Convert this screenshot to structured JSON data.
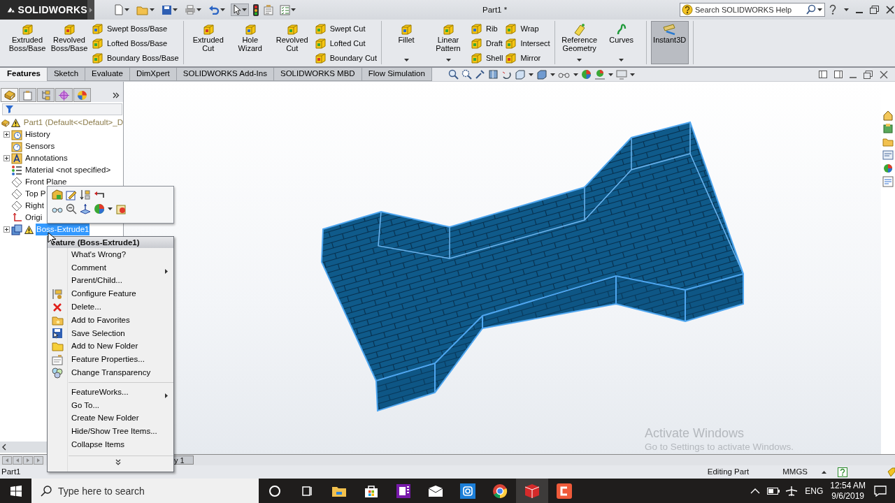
{
  "app": {
    "logo": "SOLIDWORKS",
    "title": "Part1 *",
    "search_placeholder": "Search SOLIDWORKS Help"
  },
  "ribbon": {
    "groups": [
      {
        "items": [
          {
            "kind": "large",
            "label": "Extruded Boss/Base",
            "dropdown": false,
            "pressed": false
          },
          {
            "kind": "large",
            "label": "Revolved Boss/Base",
            "dropdown": false,
            "pressed": false
          },
          {
            "kind": "stack",
            "labels": [
              "Swept Boss/Base",
              "Lofted Boss/Base",
              "Boundary Boss/Base"
            ]
          }
        ]
      },
      {
        "items": [
          {
            "kind": "large",
            "label": "Extruded Cut",
            "dropdown": false,
            "pressed": false
          },
          {
            "kind": "large",
            "label": "Hole Wizard",
            "dropdown": false,
            "pressed": false
          },
          {
            "kind": "large",
            "label": "Revolved Cut",
            "dropdown": false,
            "pressed": false
          },
          {
            "kind": "stack",
            "labels": [
              "Swept Cut",
              "Lofted Cut",
              "Boundary Cut"
            ]
          }
        ]
      },
      {
        "items": [
          {
            "kind": "large",
            "label": "Fillet",
            "dropdown": true,
            "pressed": false
          },
          {
            "kind": "large",
            "label": "Linear Pattern",
            "dropdown": true,
            "pressed": false
          },
          {
            "kind": "stack",
            "labels": [
              "Rib",
              "Draft",
              "Shell"
            ]
          },
          {
            "kind": "stack",
            "labels": [
              "Wrap",
              "Intersect",
              "Mirror"
            ]
          }
        ]
      },
      {
        "items": [
          {
            "kind": "large",
            "label": "Reference Geometry",
            "dropdown": true,
            "pressed": false
          },
          {
            "kind": "large",
            "label": "Curves",
            "dropdown": true,
            "pressed": false
          }
        ]
      },
      {
        "items": [
          {
            "kind": "large",
            "label": "Instant3D",
            "dropdown": false,
            "pressed": true
          }
        ]
      }
    ]
  },
  "tabs": [
    {
      "label": "Features",
      "selected": true
    },
    {
      "label": "Sketch",
      "selected": false
    },
    {
      "label": "Evaluate",
      "selected": false
    },
    {
      "label": "DimXpert",
      "selected": false
    },
    {
      "label": "SOLIDWORKS Add-Ins",
      "selected": false
    },
    {
      "label": "SOLIDWORKS MBD",
      "selected": false
    },
    {
      "label": "Flow Simulation",
      "selected": false
    }
  ],
  "tree": {
    "root": {
      "label": "Part1  (Default<<Default>_D",
      "warning": true
    },
    "items": [
      {
        "label": "History",
        "kind": "history",
        "collapsed": true,
        "warning": false,
        "selected": false
      },
      {
        "label": "Sensors",
        "kind": "sensors",
        "collapsed": false,
        "warning": false,
        "selected": false
      },
      {
        "label": "Annotations",
        "kind": "annotations",
        "collapsed": true,
        "warning": false,
        "selected": false
      },
      {
        "label": "Material <not specified>",
        "kind": "material",
        "collapsed": false,
        "warning": false,
        "selected": false
      },
      {
        "label": "Front Plane",
        "kind": "plane",
        "collapsed": false,
        "warning": false,
        "selected": false
      },
      {
        "label": "Top P",
        "kind": "plane",
        "collapsed": false,
        "warning": false,
        "selected": false
      },
      {
        "label": "Right",
        "kind": "plane",
        "collapsed": false,
        "warning": false,
        "selected": false
      },
      {
        "label": "Origi",
        "kind": "origin",
        "collapsed": false,
        "warning": false,
        "selected": false
      },
      {
        "label": "Boss-Extrude1",
        "kind": "feature",
        "collapsed": true,
        "warning": true,
        "selected": true
      }
    ]
  },
  "context_menu": {
    "title": "eature (Boss-Extrude1)",
    "sections": [
      [
        {
          "label": "What's Wrong?",
          "submenu": false
        },
        {
          "label": "Comment",
          "submenu": true
        },
        {
          "label": "Parent/Child...",
          "submenu": false
        },
        {
          "label": "Configure Feature",
          "submenu": false
        },
        {
          "label": "Delete...",
          "submenu": false
        },
        {
          "label": "Add to Favorites",
          "submenu": false
        },
        {
          "label": "Save Selection",
          "submenu": false
        },
        {
          "label": "Add to New Folder",
          "submenu": false
        },
        {
          "label": "Feature Properties...",
          "submenu": false
        },
        {
          "label": "Change Transparency",
          "submenu": false
        }
      ],
      [
        {
          "label": "FeatureWorks...",
          "submenu": true
        },
        {
          "label": "Go To...",
          "submenu": false
        },
        {
          "label": "Create New Folder",
          "submenu": false
        },
        {
          "label": "Hide/Show Tree Items...",
          "submenu": false
        },
        {
          "label": "Collapse Items",
          "submenu": false
        }
      ]
    ]
  },
  "model_tab": "y 1",
  "status_bar": {
    "document": "Part1",
    "mode": "Editing Part",
    "units": "MMGS"
  },
  "activation": {
    "title": "Activate Windows",
    "message": "Go to Settings to activate Windows."
  },
  "taskbar": {
    "search_placeholder": "Type here to search",
    "apps": [
      {
        "kind": "cortana",
        "selected": false
      },
      {
        "kind": "taskview",
        "selected": false
      },
      {
        "kind": "explorer",
        "selected": false
      },
      {
        "kind": "store",
        "selected": false
      },
      {
        "kind": "onenote",
        "selected": false
      },
      {
        "kind": "mail",
        "selected": false
      },
      {
        "kind": "camera",
        "selected": false
      },
      {
        "kind": "browser",
        "selected": false
      },
      {
        "kind": "cad",
        "selected": true
      },
      {
        "kind": "recorder",
        "selected": false
      }
    ],
    "language": "ENG",
    "time": "12:54 AM",
    "date": "9/6/2019"
  }
}
